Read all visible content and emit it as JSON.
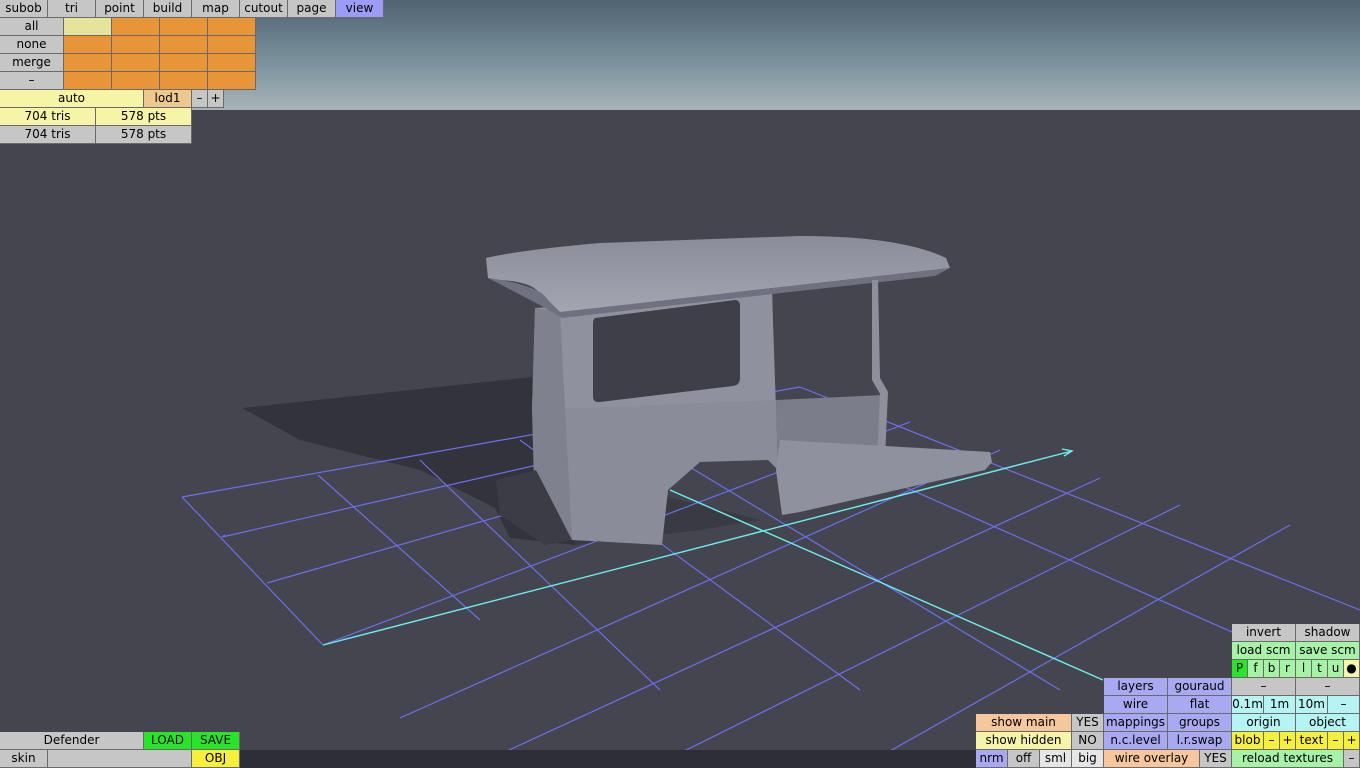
{
  "menu": {
    "items": [
      "subob",
      "tri",
      "point",
      "build",
      "map",
      "cutout",
      "page",
      "view"
    ],
    "active": "view"
  },
  "select_panel": {
    "rows": [
      "all",
      "none",
      "merge",
      "–"
    ]
  },
  "lod_panel": {
    "auto_label": "auto",
    "lod_label": "lod1",
    "minus_label": "–",
    "plus_label": "+"
  },
  "stats": [
    {
      "tris": "704 tris",
      "pts": "578 pts"
    },
    {
      "tris": "704 tris",
      "pts": "578 pts"
    }
  ],
  "model": {
    "name": "Defender",
    "load_label": "LOAD",
    "save_label": "SAVE",
    "skin_label": "skin",
    "skin_value": "",
    "obj_label": "OBJ"
  },
  "view_panel": {
    "invert": "invert",
    "shadow": "shadow",
    "load_scm": "load scm",
    "save_scm": "save scm",
    "view_keys": [
      "P",
      "f",
      "b",
      "r",
      "l",
      "t",
      "u",
      "●"
    ],
    "dash1": "–",
    "dash2": "–",
    "layers": "layers",
    "gouraud": "gouraud",
    "wire": "wire",
    "flat": "flat",
    "grid_sizes": [
      "0.1m",
      "1m",
      "10m"
    ],
    "grid_minus": "–",
    "mappings": "mappings",
    "groups": "groups",
    "origin": "origin",
    "object": "object",
    "nc_level": "n.c.level",
    "lr_swap": "l.r.swap",
    "blob": "blob",
    "blob_minus": "–",
    "blob_plus": "+",
    "text": "text",
    "text_minus": "–",
    "text_plus": "+",
    "wire_overlay": "wire overlay",
    "wire_overlay_value": "YES",
    "reload_textures": "reload textures",
    "reload_minus": "–"
  },
  "show_panel": {
    "show_main": "show main",
    "show_main_value": "YES",
    "show_hidden": "show hidden",
    "show_hidden_value": "NO",
    "normals": [
      "nrm",
      "off",
      "sml",
      "big"
    ]
  }
}
